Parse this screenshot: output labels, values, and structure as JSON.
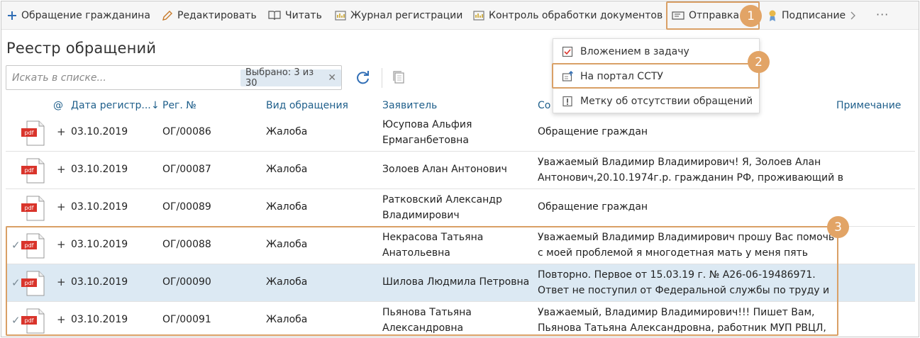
{
  "toolbar": {
    "items": [
      {
        "label": "Обращение гражданина",
        "icon": "plus-icon"
      },
      {
        "label": "Редактировать",
        "icon": "pencil-icon"
      },
      {
        "label": "Читать",
        "icon": "book-icon"
      },
      {
        "label": "Журнал регистрации",
        "icon": "journal-icon"
      },
      {
        "label": "Контроль обработки документов",
        "icon": "chart-icon"
      },
      {
        "label": "Отправка",
        "icon": "send-icon"
      },
      {
        "label": "Подписание",
        "icon": "signature-icon"
      }
    ],
    "more": "···"
  },
  "page_title": "Реестр обращений",
  "search": {
    "placeholder": "Искать в списке...",
    "selected_label": "Выбрано: 3 из 30"
  },
  "table": {
    "columns": [
      "@",
      "Дата регистр...",
      "Рег. №",
      "Вид обращения",
      "Заявитель",
      "Со",
      "Примечание"
    ],
    "rows": [
      {
        "plus": "+",
        "date": "03.10.2019",
        "reg": "ОГ/00086",
        "type": "Жалоба",
        "applicant": [
          "Юсупова Альфия",
          "Ермаганбетовна"
        ],
        "content": [
          "Обращение граждан"
        ],
        "checked": false
      },
      {
        "plus": "+",
        "date": "03.10.2019",
        "reg": "ОГ/00087",
        "type": "Жалоба",
        "applicant": [
          "Золоев Алан Антонович"
        ],
        "content": [
          "Уважаемый Владимир Владимирович! Я, Золоев Алан",
          "Антонович,20.10.1974г.р. гражданин РФ, проживающий в"
        ],
        "checked": false
      },
      {
        "plus": "+",
        "date": "03.10.2019",
        "reg": "ОГ/00089",
        "type": "Жалоба",
        "applicant": [
          "Ратковский Александр",
          "Владимирович"
        ],
        "content": [
          "Обращение граждан"
        ],
        "checked": false
      },
      {
        "plus": "+",
        "date": "03.10.2019",
        "reg": "ОГ/00088",
        "type": "Жалоба",
        "applicant": [
          "Некрасова Татьяна",
          "Анатольевна"
        ],
        "content": [
          "Уважаемый Владимир Владимирович прошу Вас помочь",
          "с моей проблемой я многодетная мать у меня пять"
        ],
        "checked": true
      },
      {
        "plus": "+",
        "date": "03.10.2019",
        "reg": "ОГ/00090",
        "type": "Жалоба",
        "applicant": [
          "Шилова Людмила Петровна"
        ],
        "content": [
          "Повторно. Первое от 15.03.19 г. № А26-06-19486971.",
          "Ответ не поступил от Федеральной службы по труду и"
        ],
        "checked": true
      },
      {
        "plus": "+",
        "date": "03.10.2019",
        "reg": "ОГ/00091",
        "type": "Жалоба",
        "applicant": [
          "Пьянова Татьяна",
          "Александровна"
        ],
        "content": [
          "Уважаемый, Владимир Владимирович!!! Пишет Вам,",
          "Пьянова Татьяна Александровна, работник МУП РВЦЛ,"
        ],
        "checked": true
      }
    ]
  },
  "dropdown": {
    "items": [
      {
        "label": "Вложением в задачу",
        "icon": "task-check-icon"
      },
      {
        "label": "На портал ССТУ",
        "icon": "portal-upload-icon"
      },
      {
        "label": "Метку об отсутствии обращений",
        "icon": "exclamation-icon"
      }
    ]
  },
  "annotations": {
    "badge1": "1",
    "badge2": "2",
    "badge3": "3"
  },
  "colors": {
    "accent_blue": "#2f6db5",
    "header_text": "#1f5f8b",
    "selected_row": "#dce9f3",
    "annotation": "#d9a066",
    "pdf_red": "#d9342b"
  }
}
